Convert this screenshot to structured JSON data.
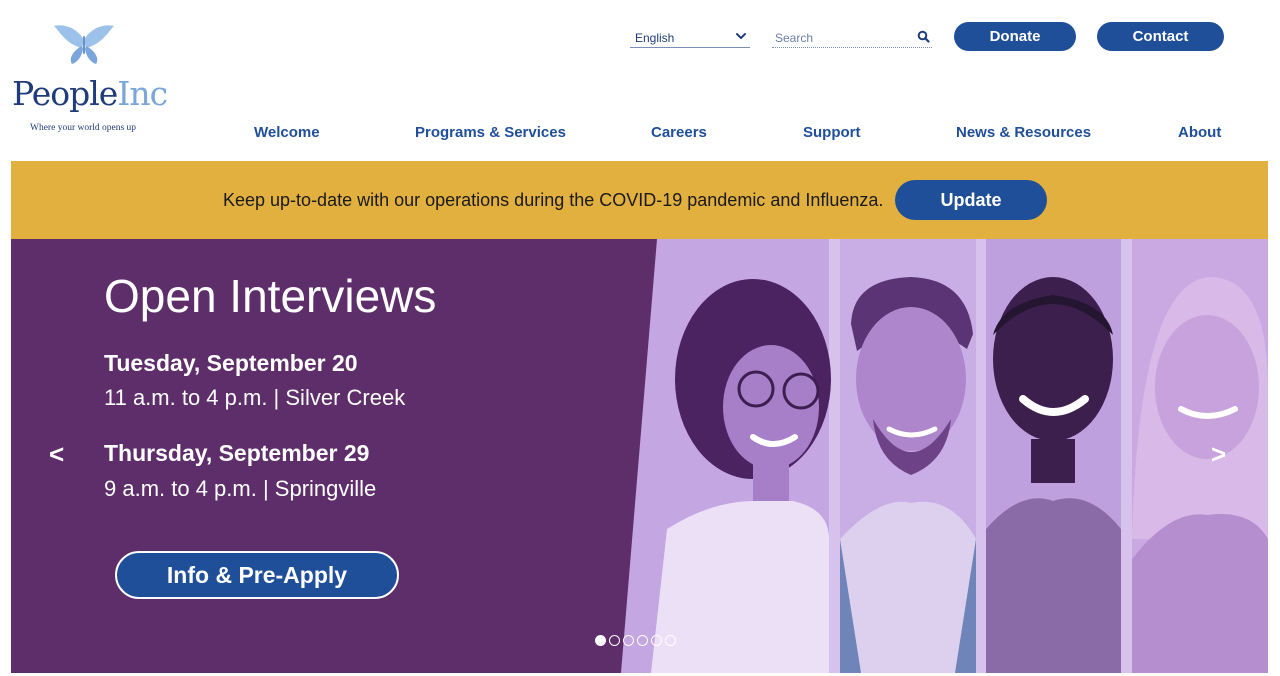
{
  "brand": {
    "name_people": "People",
    "name_inc": "Inc",
    "tagline": "Where your world opens up",
    "logo_color": "#1f3d7a",
    "accent_light": "#7aa6dc"
  },
  "header": {
    "language": {
      "selected": "English",
      "icon": "chevron-down-icon"
    },
    "search": {
      "placeholder": "Search",
      "icon": "search-icon"
    },
    "donate_label": "Donate",
    "contact_label": "Contact"
  },
  "nav": {
    "items": [
      {
        "label": "Welcome"
      },
      {
        "label": "Programs & Services"
      },
      {
        "label": "Careers"
      },
      {
        "label": "Support"
      },
      {
        "label": "News & Resources"
      },
      {
        "label": "About"
      }
    ]
  },
  "alert": {
    "text": "Keep up-to-date with our operations during the COVID-19 pandemic and Influenza.",
    "button_label": "Update",
    "bg_color": "#e2b03f"
  },
  "hero": {
    "title": "Open Interviews",
    "events": [
      {
        "date": "Tuesday, September 20",
        "details": "11 a.m. to 4 p.m. | Silver Creek"
      },
      {
        "date": "Thursday, September 29",
        "details": "9 a.m. to 4 p.m. | Springville"
      }
    ],
    "cta_label": "Info & Pre-Apply",
    "prev_arrow": "<",
    "next_arrow": ">",
    "slide_count": 6,
    "active_slide": 1,
    "bg_color": "#5e2e6b"
  },
  "colors": {
    "primary_blue": "#1f4f99",
    "photo_tint": "#c7ade6"
  }
}
